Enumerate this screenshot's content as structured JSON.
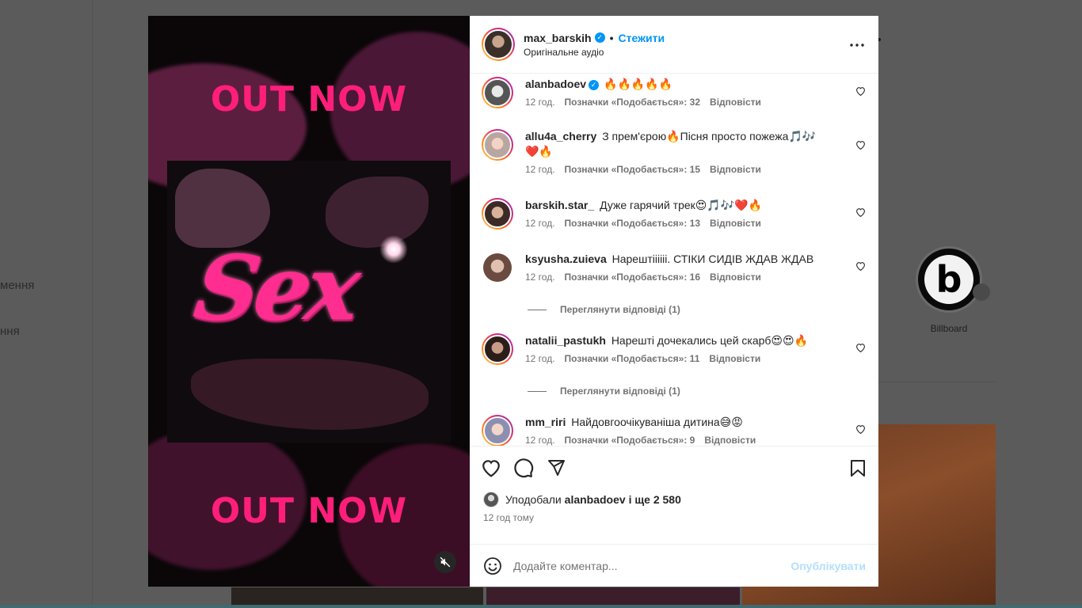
{
  "background": {
    "nav_items": [
      "мення",
      "ння"
    ],
    "story_label": "Billboard",
    "story_logo_letter": "b"
  },
  "post": {
    "author": "max_barskih",
    "follow_label": "Стежити",
    "dot": "•",
    "subtitle": "Оригінальне аудіо",
    "more_icon": "more-horizontal-icon",
    "media": {
      "top_text": "OUT NOW",
      "bottom_text": "OUT NOW",
      "cover_word": "Sex"
    }
  },
  "comments": [
    {
      "user": "alanbadoev",
      "verified": true,
      "text": "🔥🔥🔥🔥🔥",
      "time": "12 год.",
      "likes": "Позначки «Подобається»: 32",
      "reply": "Відповісти"
    },
    {
      "user": "allu4a_cherry",
      "verified": false,
      "text": "З прем'єрою🔥Пісня просто пожежа🎵🎶❤️🔥",
      "time": "12 год.",
      "likes": "Позначки «Подобається»: 15",
      "reply": "Відповісти"
    },
    {
      "user": "barskih.star_",
      "verified": false,
      "text": "Дуже гарячий трек😍🎵🎶❤️🔥",
      "time": "12 год.",
      "likes": "Позначки «Подобається»: 13",
      "reply": "Відповісти"
    },
    {
      "user": "ksyusha.zuieva",
      "verified": false,
      "text": "Нарештіііііі. СТІКИ СИДІВ ЖДАВ ЖДАВ",
      "time": "12 год.",
      "likes": "Позначки «Подобається»: 16",
      "reply": "Відповісти",
      "view_replies": "Переглянути відповіді (1)"
    },
    {
      "user": "natalii_pastukh",
      "verified": false,
      "text": "Нарешті дочекались цей скарб😍😍🔥",
      "time": "12 год.",
      "likes": "Позначки «Подобається»: 11",
      "reply": "Відповісти",
      "view_replies": "Переглянути відповіді (1)"
    },
    {
      "user": "mm_riri",
      "verified": false,
      "text": "Найдовгоочікуваніша дитина😅😡",
      "time": "12 год.",
      "likes": "Позначки «Подобається»: 9",
      "reply": "Відповісти"
    }
  ],
  "actions": {
    "like_icon": "heart-icon",
    "comment_icon": "comment-icon",
    "share_icon": "send-icon",
    "save_icon": "bookmark-icon"
  },
  "likes_summary": {
    "prefix": "Уподобали",
    "user": "alanbadoev",
    "rest": "і ще 2 580"
  },
  "post_time": "12 год тому",
  "comment_box": {
    "placeholder": "Додайте коментар...",
    "publish_label": "Опублікувати"
  },
  "colors": {
    "accent": "#0095f6",
    "out_now": "#ff1f7a",
    "publish_disabled": "#b2dffc"
  }
}
